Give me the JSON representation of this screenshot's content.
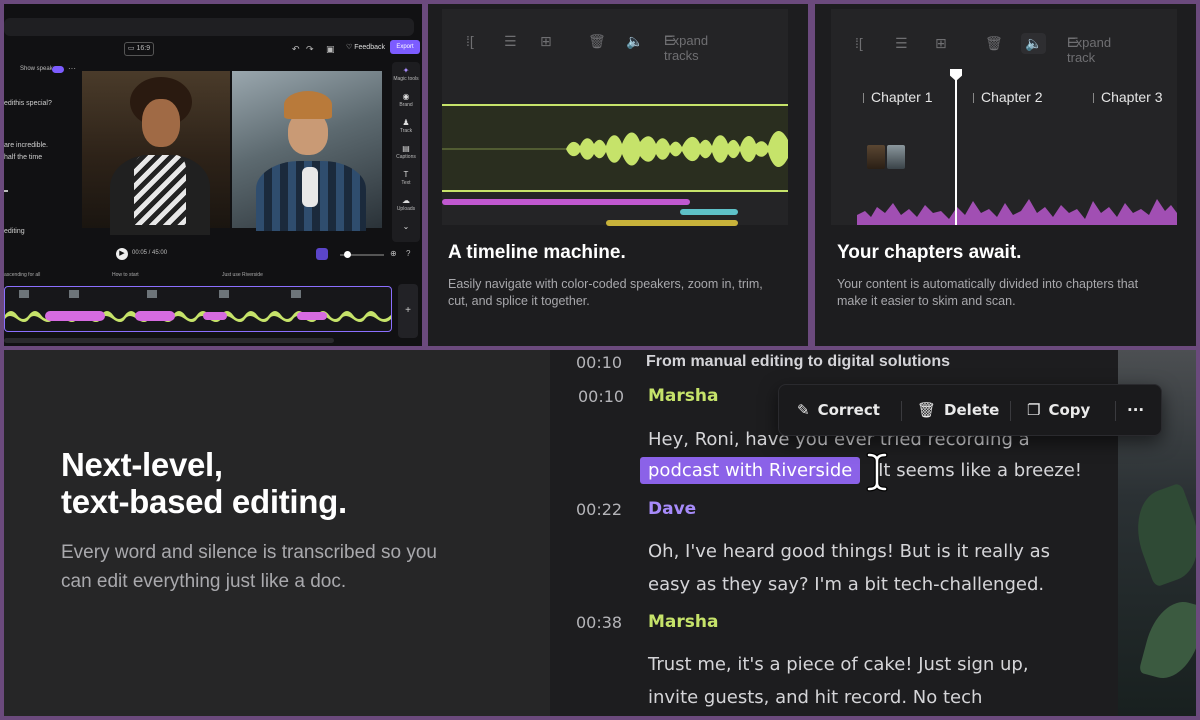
{
  "editor": {
    "show_speaker": "Show speaker",
    "feedback": "Feedback",
    "export": "Export",
    "transcript_lines": [
      "edithis special?",
      "are incredible.",
      "half the time",
      "editing"
    ],
    "sidebar": [
      {
        "icon": "✦",
        "label": "Magic tools"
      },
      {
        "icon": "◉",
        "label": "Brand"
      },
      {
        "icon": "♟",
        "label": "Track"
      },
      {
        "icon": "▤",
        "label": "Captions"
      },
      {
        "icon": "T",
        "label": "Text"
      },
      {
        "icon": "☁",
        "label": "Uploads"
      },
      {
        "icon": "⌄",
        "label": ""
      }
    ],
    "time": "00:05 / 45:00",
    "chapters": [
      "ascending for all",
      "How to start",
      "Just use Riverside"
    ]
  },
  "timeline_card": {
    "expand_label": "Expand tracks",
    "title": "A timeline machine.",
    "description": "Easily navigate with color-coded speakers, zoom in, trim, cut, and splice it together."
  },
  "chapters_card": {
    "expand_label": "Expand track",
    "chapters": [
      "Chapter 1",
      "Chapter 2",
      "Chapter 3"
    ],
    "title": "Your chapters await.",
    "description": "Your content is automatically divided into chapters that make it easier to skim and scan."
  },
  "text_editing": {
    "title_line1": "Next-level,",
    "title_line2": "text-based editing.",
    "description": "Every word and silence is transcribed so you can edit everything just like a doc.",
    "chapter_time": "00:10",
    "chapter_title": "From manual editing to digital solutions",
    "context_menu": {
      "correct": "Correct",
      "delete": "Delete",
      "copy": "Copy",
      "more": "···"
    },
    "entries": [
      {
        "time": "00:10",
        "speaker": "Marsha",
        "color": "#c6e36a",
        "lines": [
          "Hey, Roni, have you ever tried recording a"
        ],
        "highlight": "podcast with Riverside",
        "after_highlight": "It seems like a breeze!"
      },
      {
        "time": "00:22",
        "speaker": "Dave",
        "color": "#a78bfa",
        "lines": [
          "Oh, I've heard good things! But is it really as",
          "easy as they say? I'm a bit tech-challenged."
        ]
      },
      {
        "time": "00:38",
        "speaker": "Marsha",
        "color": "#c6e36a",
        "lines": [
          "Trust me, it's a piece of cake! Just sign up,",
          "invite guests, and hit record. No tech"
        ]
      }
    ]
  },
  "colors": {
    "accent": "#7c5cff",
    "lime": "#c6e36a",
    "pink": "#c058d0",
    "teal": "#5ec1c8",
    "mustard": "#c8b23a",
    "highlight": "#8b62e8"
  }
}
